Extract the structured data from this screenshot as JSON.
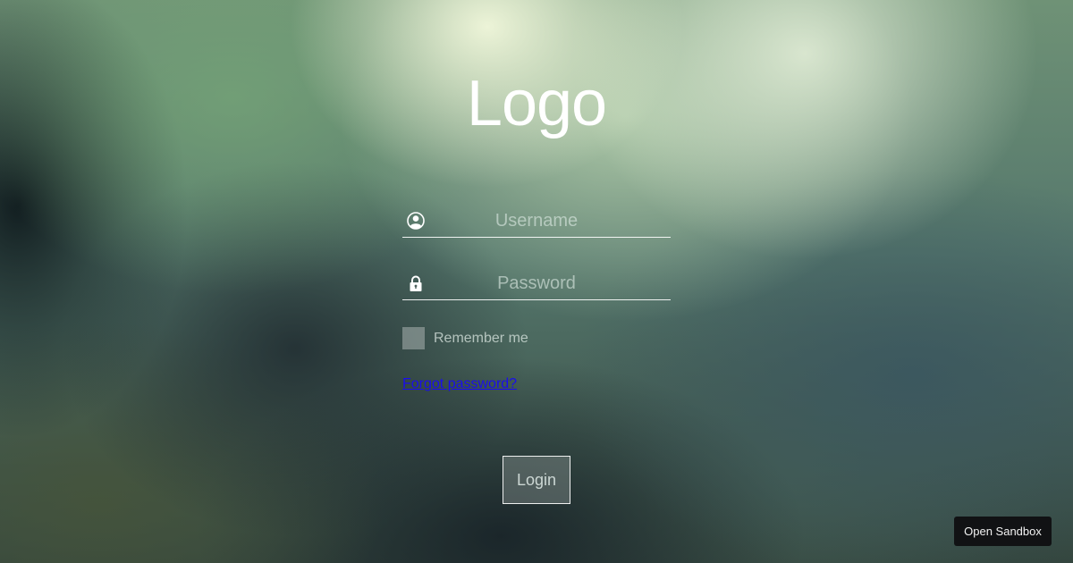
{
  "logo": {
    "text": "Logo"
  },
  "form": {
    "username": {
      "placeholder": "Username",
      "value": "",
      "icon": "user-icon"
    },
    "password": {
      "placeholder": "Password",
      "value": "",
      "icon": "lock-icon"
    },
    "remember": {
      "label": "Remember me",
      "checked": false
    },
    "forgot_link": "Forgot password?",
    "login_label": "Login"
  },
  "sandbox": {
    "label": "Open Sandbox"
  },
  "colors": {
    "link": "#1a0dee",
    "text": "#ffffff",
    "sandbox_bg": "#111214"
  }
}
